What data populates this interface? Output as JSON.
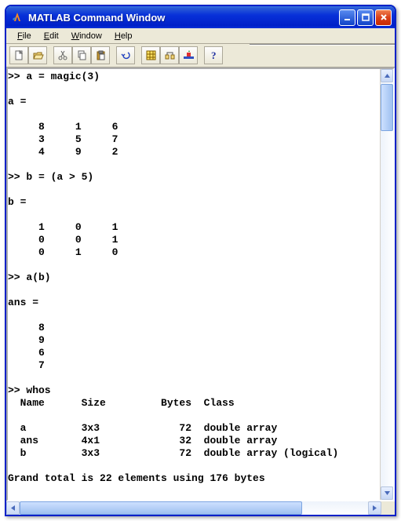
{
  "window": {
    "title": "MATLAB Command Window"
  },
  "menu": {
    "file": "File",
    "edit": "Edit",
    "window": "Window",
    "help": "Help"
  },
  "session_text": ">> a = magic(3)\n\na =\n\n     8     1     6\n     3     5     7\n     4     9     2\n\n>> b = (a > 5)\n\nb =\n\n     1     0     1\n     0     0     1\n     0     1     0\n\n>> a(b)\n\nans =\n\n     8\n     9\n     6\n     7\n\n>> whos\n  Name      Size         Bytes  Class\n\n  a         3x3             72  double array\n  ans       4x1             32  double array\n  b         3x3             72  double array (logical)\n\nGrand total is 22 elements using 176 bytes\n\n>> ",
  "chart_data": {
    "type": "table",
    "title": "whos",
    "columns": [
      "Name",
      "Size",
      "Bytes",
      "Class"
    ],
    "rows": [
      [
        "a",
        "3x3",
        72,
        "double array"
      ],
      [
        "ans",
        "4x1",
        32,
        "double array"
      ],
      [
        "b",
        "3x3",
        72,
        "double array (logical)"
      ]
    ],
    "summary": "Grand total is 22 elements using 176 bytes"
  },
  "matrices": {
    "a": [
      [
        8,
        1,
        6
      ],
      [
        3,
        5,
        7
      ],
      [
        4,
        9,
        2
      ]
    ],
    "b": [
      [
        1,
        0,
        1
      ],
      [
        0,
        0,
        1
      ],
      [
        0,
        1,
        0
      ]
    ],
    "ans": [
      8,
      9,
      6,
      7
    ]
  }
}
